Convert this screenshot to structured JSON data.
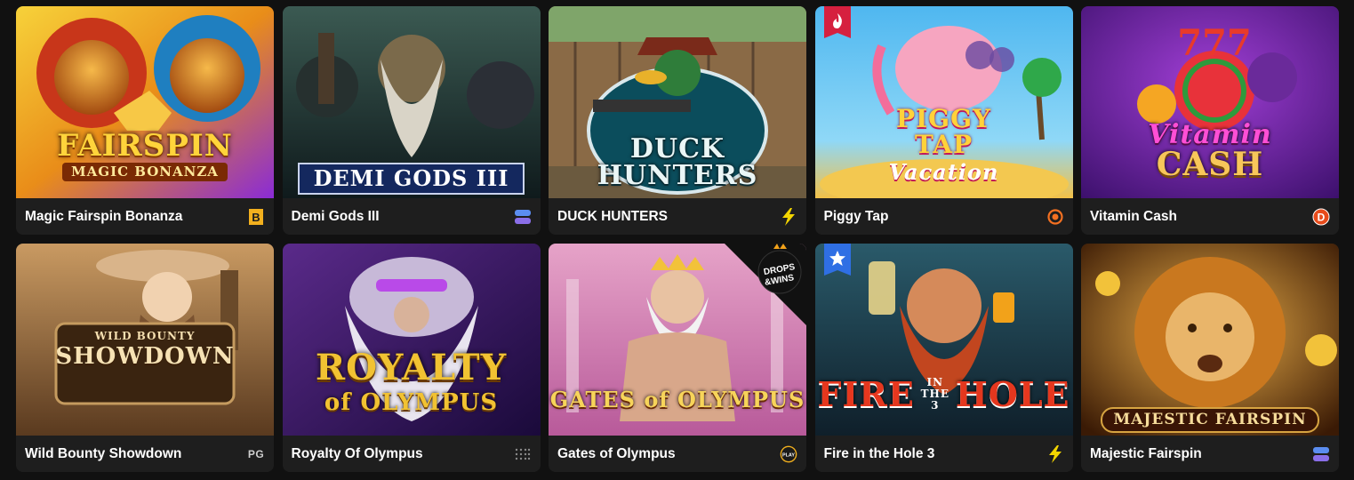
{
  "games": [
    {
      "title": "Magic Fairspin Bonanza",
      "logo1": "FAIRSPIN",
      "logo2": "MAGIC BONANZA",
      "provider_icon": "b-square-icon",
      "accent": "#f2b01e"
    },
    {
      "title": "Demi Gods III",
      "logo1": "DEMI GODS III",
      "logo2": "",
      "provider_icon": "stacked-bars-icon",
      "accent": "#3c5bd6"
    },
    {
      "title": "DUCK HUNTERS",
      "logo1": "DUCK HUNTERS",
      "logo2": "",
      "provider_icon": "lightning-icon",
      "accent": "#f3d500"
    },
    {
      "title": "Piggy Tap",
      "logo1": "PIGGY TAP",
      "logo2": "Vacation",
      "provider_icon": "circle-dot-icon",
      "accent": "#f37021"
    },
    {
      "title": "Vitamin Cash",
      "logo1": "Vitamin",
      "logo2": "CASH",
      "provider_icon": "d-circle-icon",
      "accent": "#e84b1b"
    },
    {
      "title": "Wild Bounty Showdown",
      "logo1": "WILD BOUNTY",
      "logo2": "SHOWDOWN",
      "provider_icon": "pg-icon",
      "provider_text": "PG",
      "accent": "#c59b5f"
    },
    {
      "title": "Royalty Of Olympus",
      "logo1": "ROYALTY",
      "logo2": "of OLYMPUS",
      "provider_icon": "dots-grid-icon",
      "accent": "#f1c232"
    },
    {
      "title": "Gates of Olympus",
      "logo1": "GATES of OLYMPUS",
      "logo2": "",
      "provider_icon": "play-circle-icon",
      "provider_text": "PLAY",
      "accent": "#f2b01e",
      "corner_badge": "DROPS & WINS"
    },
    {
      "title": "Fire in the Hole 3",
      "logo1": "FIRE",
      "logo2": "HOLE",
      "logo_mid": "IN THE 3",
      "provider_icon": "lightning-icon",
      "accent": "#f3d500"
    },
    {
      "title": "Majestic Fairspin",
      "logo1": "MAJESTIC FAIRSPIN",
      "logo2": "",
      "provider_icon": "stacked-bars-icon",
      "accent": "#d7a441"
    }
  ],
  "badge_colors": {
    "hot": "#d6203f",
    "star": "#2f6fe4"
  }
}
